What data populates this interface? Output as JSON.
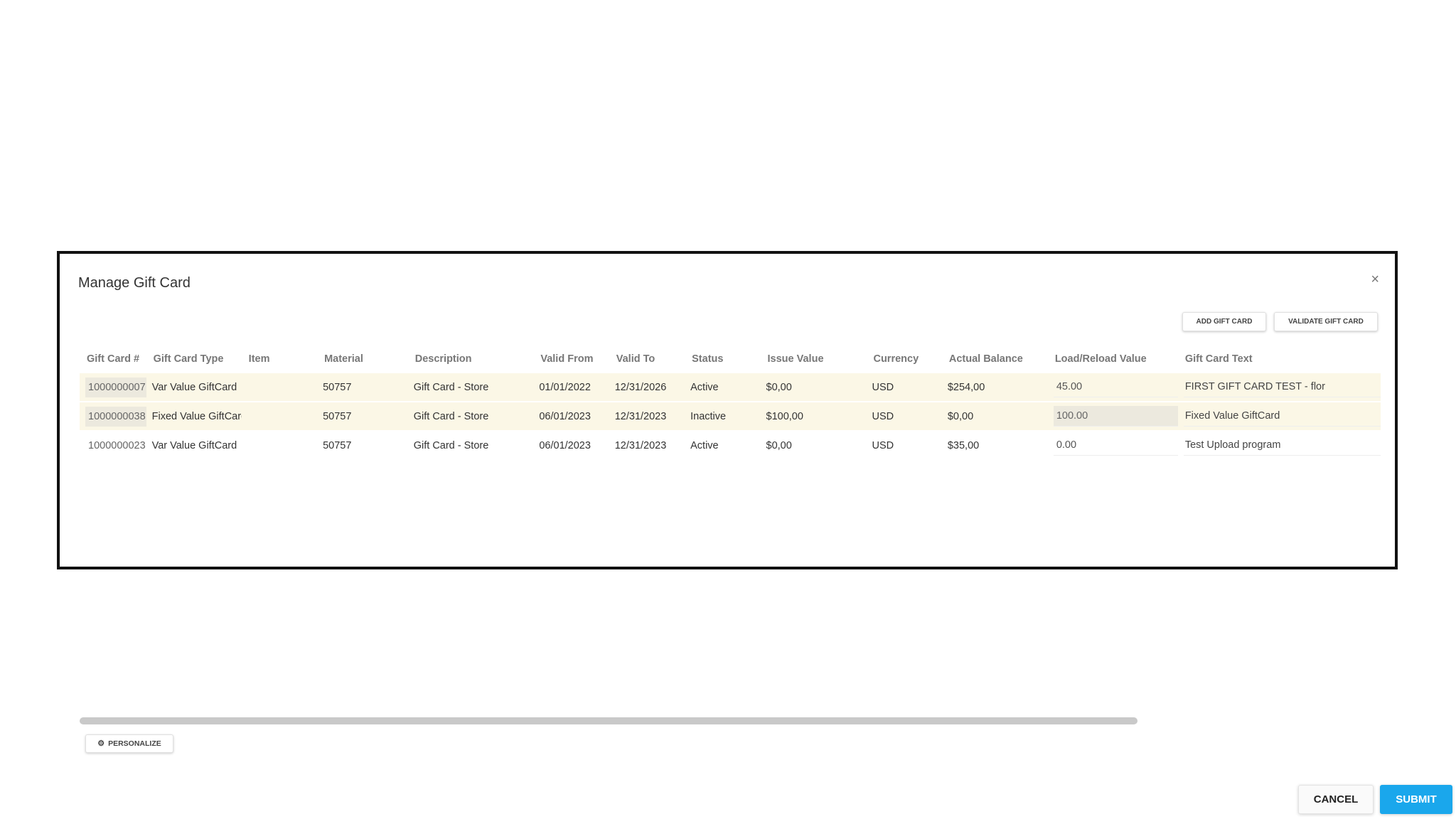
{
  "dialog": {
    "title": "Manage Gift Card",
    "close_icon": "close-icon",
    "close_glyph": "×"
  },
  "actions": {
    "add_gift_card": "ADD GIFT CARD",
    "validate_gift_card": "VALIDATE GIFT CARD"
  },
  "table": {
    "columns": [
      "Gift Card #",
      "Gift Card Type",
      "Item",
      "Material",
      "Description",
      "Valid From",
      "Valid To",
      "Status",
      "Issue Value",
      "Currency",
      "Actual Balance",
      "Load/Reload Value",
      "Gift Card Text"
    ],
    "rows": [
      {
        "gift_card_no": "1000000007",
        "type": "Var Value GiftCard",
        "item": "",
        "material": "50757",
        "description": "Gift Card - Store",
        "valid_from": "01/01/2022",
        "valid_to": "12/31/2026",
        "status": "Active",
        "issue_value": "$0,00",
        "currency": "USD",
        "actual_balance": "$254,00",
        "load_reload": "45.00",
        "gift_card_text": "FIRST GIFT CARD TEST - flor"
      },
      {
        "gift_card_no": "1000000038",
        "type": "Fixed Value GiftCard",
        "item": "",
        "material": "50757",
        "description": "Gift Card - Store",
        "valid_from": "06/01/2023",
        "valid_to": "12/31/2023",
        "status": "Inactive",
        "issue_value": "$100,00",
        "currency": "USD",
        "actual_balance": "$0,00",
        "load_reload": "100.00",
        "gift_card_text": "Fixed Value GiftCard"
      },
      {
        "gift_card_no": "1000000023",
        "type": "Var Value GiftCard",
        "item": "",
        "material": "50757",
        "description": "Gift Card - Store",
        "valid_from": "06/01/2023",
        "valid_to": "12/31/2023",
        "status": "Active",
        "issue_value": "$0,00",
        "currency": "USD",
        "actual_balance": "$35,00",
        "load_reload": "0.00",
        "gift_card_text": "Test Upload program"
      }
    ]
  },
  "personalize": {
    "label": "PERSONALIZE",
    "icon": "gear-icon",
    "glyph": "⚙"
  },
  "footer": {
    "cancel": "CANCEL",
    "submit": "SUBMIT"
  },
  "colors": {
    "submit": "#1aa7ec",
    "row_highlight": "#fbf7e6",
    "border": "#111111"
  }
}
